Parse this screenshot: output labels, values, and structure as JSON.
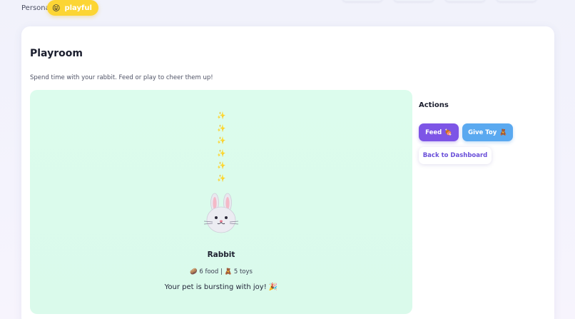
{
  "persona": {
    "label": "Persona:",
    "value": "playful",
    "emoji": "😝"
  },
  "page": {
    "title": "Playroom",
    "subtitle": "Spend time with your rabbit. Feed or play to cheer them up!"
  },
  "stage": {
    "sparkles": [
      "✨",
      "✨",
      "✨",
      "✨",
      "✨",
      "✨"
    ],
    "pet_name": "Rabbit",
    "food_icon": "🥔",
    "food": "6 food",
    "separator": "|",
    "toy_icon": "🧸",
    "toys": "5 toys",
    "mood": "Your pet is bursting with joy!",
    "mood_emoji": "🎉"
  },
  "actions": {
    "title": "Actions",
    "feed_label": "Feed",
    "feed_icon": "🍖",
    "toy_label": "Give Toy",
    "toy_icon": "🧸",
    "back_label": "Back to Dashboard"
  },
  "colors": {
    "accent_purple": "#7d55e6",
    "accent_blue": "#5aa9f0",
    "persona_yellow": "#fcd534",
    "stage_green": "#dcfced"
  }
}
